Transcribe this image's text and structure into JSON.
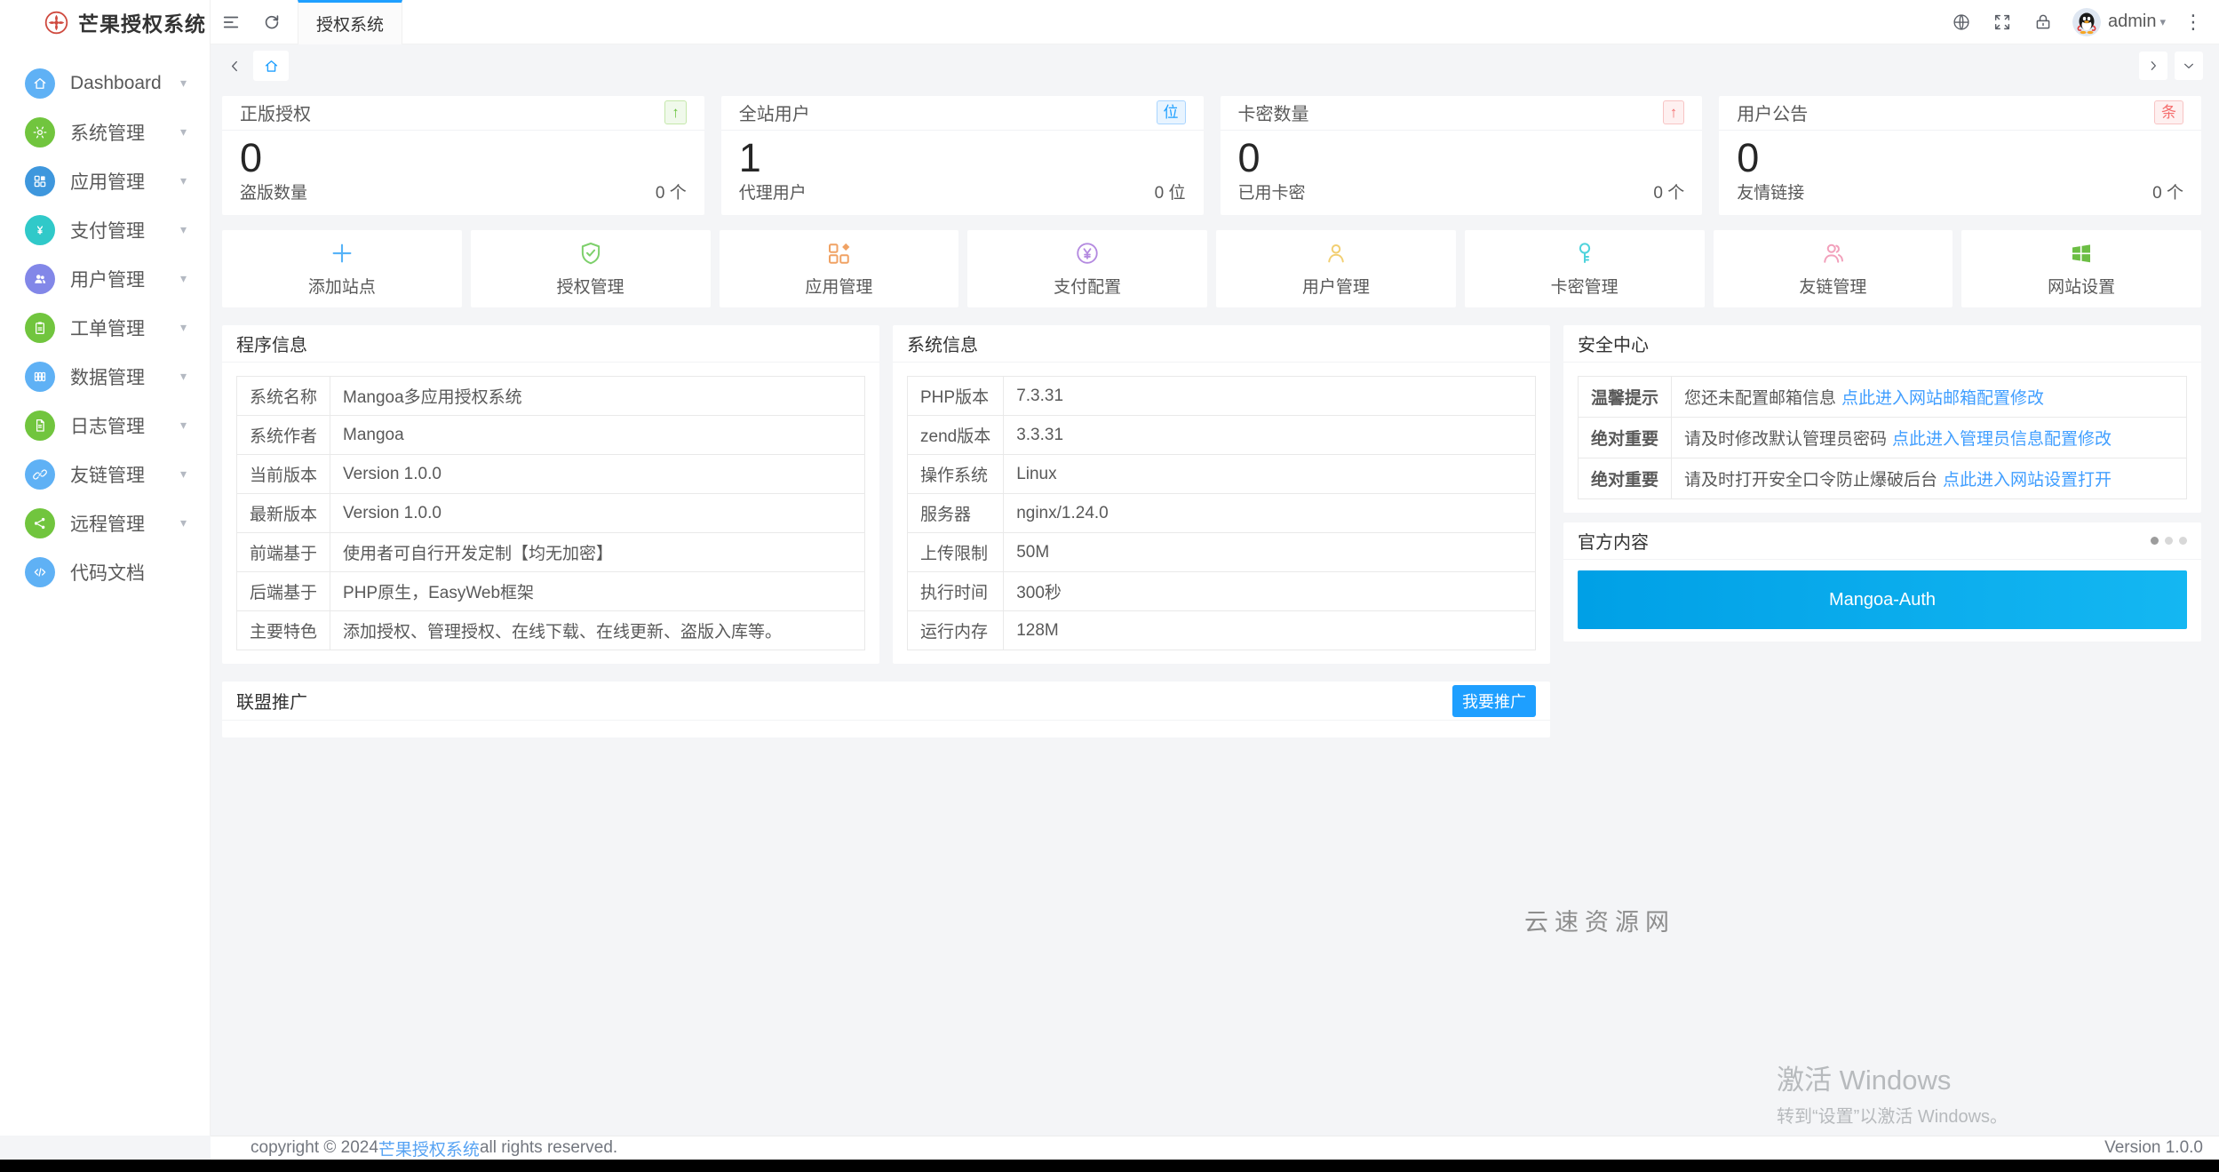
{
  "colors": {
    "accent_blue": "#1e9fff",
    "link_blue": "#409eff",
    "tip_blue": "#2b36c9",
    "important_red": "#e13c39",
    "latest_version_red": "#e74c4c",
    "banner_gradient_left": "#00a0e6",
    "banner_gradient_right": "#14b7f2",
    "sidebar_icon_blue": "#5fb1f5",
    "sidebar_icon_green": "#71c53e",
    "sidebar_icon_dark_blue": "#3e97dd",
    "sidebar_icon_teal": "#30c9c9",
    "sidebar_icon_purple": "#8287e8"
  },
  "header": {
    "logo_title": "芒果授权系统",
    "tab_label": "授权系统",
    "username": "admin"
  },
  "sidebar": {
    "items": [
      {
        "label": "Dashboard"
      },
      {
        "label": "系统管理"
      },
      {
        "label": "应用管理"
      },
      {
        "label": "支付管理"
      },
      {
        "label": "用户管理"
      },
      {
        "label": "工单管理"
      },
      {
        "label": "数据管理"
      },
      {
        "label": "日志管理"
      },
      {
        "label": "友链管理"
      },
      {
        "label": "远程管理"
      },
      {
        "label": "代码文档"
      }
    ]
  },
  "stats": [
    {
      "title": "正版授权",
      "badge": "↑",
      "value": "0",
      "foot_label": "盗版数量",
      "foot_value": "0 个"
    },
    {
      "title": "全站用户",
      "badge": "位",
      "value": "1",
      "foot_label": "代理用户",
      "foot_value": "0 位"
    },
    {
      "title": "卡密数量",
      "badge": "↑",
      "value": "0",
      "foot_label": "已用卡密",
      "foot_value": "0 个"
    },
    {
      "title": "用户公告",
      "badge": "条",
      "value": "0",
      "foot_label": "友情链接",
      "foot_value": "0 个"
    }
  ],
  "quick_actions": [
    {
      "label": "添加站点"
    },
    {
      "label": "授权管理"
    },
    {
      "label": "应用管理"
    },
    {
      "label": "支付配置"
    },
    {
      "label": "用户管理"
    },
    {
      "label": "卡密管理"
    },
    {
      "label": "友链管理"
    },
    {
      "label": "网站设置"
    }
  ],
  "program_info": {
    "title": "程序信息",
    "rows": [
      {
        "label": "系统名称",
        "value": "Mangoa多应用授权系统"
      },
      {
        "label": "系统作者",
        "value": "Mangoa"
      },
      {
        "label": "当前版本",
        "value": "Version 1.0.0"
      },
      {
        "label": "最新版本",
        "value": "Version 1.0.0"
      },
      {
        "label": "前端基于",
        "value": "使用者可自行开发定制【均无加密】"
      },
      {
        "label": "后端基于",
        "value": "PHP原生，EasyWeb框架"
      },
      {
        "label": "主要特色",
        "value": "添加授权、管理授权、在线下载、在线更新、盗版入库等。"
      }
    ]
  },
  "system_info": {
    "title": "系统信息",
    "rows": [
      {
        "label": "PHP版本",
        "value": "7.3.31"
      },
      {
        "label": "zend版本",
        "value": "3.3.31"
      },
      {
        "label": "操作系统",
        "value": "Linux"
      },
      {
        "label": "服务器",
        "value": "nginx/1.24.0"
      },
      {
        "label": "上传限制",
        "value": "50M"
      },
      {
        "label": "执行时间",
        "value": "300秒"
      },
      {
        "label": "运行内存",
        "value": "128M"
      }
    ]
  },
  "security": {
    "title": "安全中心",
    "rows": [
      {
        "tag": "温馨提示",
        "text": "您还未配置邮箱信息",
        "link": "点此进入网站邮箱配置修改"
      },
      {
        "tag": "绝对重要",
        "text": "请及时修改默认管理员密码",
        "link": "点此进入管理员信息配置修改"
      },
      {
        "tag": "绝对重要",
        "text": "请及时打开安全口令防止爆破后台",
        "link": "点此进入网站设置打开"
      }
    ]
  },
  "official": {
    "title": "官方内容",
    "banner_text": "Mangoa-Auth"
  },
  "promo": {
    "title": "联盟推广",
    "button_label": "我要推广"
  },
  "watermark": {
    "site": "云速资源网",
    "activate_line1": "激活 Windows",
    "activate_line2": "转到“设置”以激活 Windows。"
  },
  "footer": {
    "copyright_prefix": "copyright © 2024 ",
    "copyright_link": "芒果授权系统",
    "copyright_suffix": " all rights reserved.",
    "version": "Version 1.0.0"
  }
}
